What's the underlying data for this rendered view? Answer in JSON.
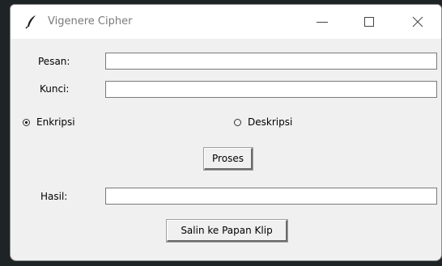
{
  "window": {
    "title": "Vigenere Cipher",
    "icon": "feather-icon"
  },
  "form": {
    "pesan_label": "Pesan:",
    "pesan_value": "",
    "kunci_label": "Kunci:",
    "kunci_value": "",
    "hasil_label": "Hasil:",
    "hasil_value": ""
  },
  "mode": {
    "selected": "Enkripsi",
    "options": [
      "Enkripsi",
      "Deskripsi"
    ]
  },
  "buttons": {
    "process_label": "Proses",
    "copy_label": "Salin ke Papan Klip"
  },
  "colors": {
    "window_bg": "#f0f0f0",
    "titlebar_bg": "#ffffff",
    "title_text": "#7a7a7a"
  }
}
